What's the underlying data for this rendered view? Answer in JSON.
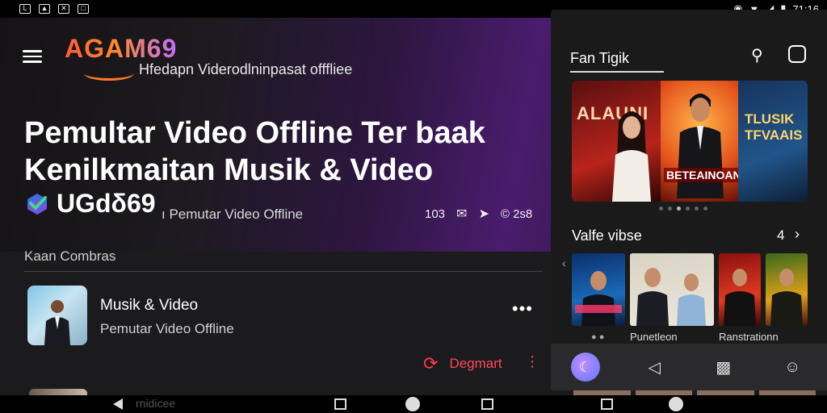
{
  "status_bar": {
    "left_icons": [
      "notification-icon",
      "photo-icon",
      "x-icon",
      "cast-icon"
    ],
    "time": "71:16"
  },
  "header": {
    "logo": "AGAM69",
    "tagline": "Hfedapn Viderodlninpasat offfliee"
  },
  "hero": {
    "headline_line1": "Pemultar Video Offline Ter baak",
    "headline_line2": "Kenilkmaitan Musik & Video",
    "brand_name": "UGdδ69",
    "sub_label": "ı Pemutar Video Offline",
    "stats": {
      "views": "103",
      "comments_icon": "chat-icon",
      "share_icon": "share-icon",
      "likes": "© 2s8"
    }
  },
  "section": {
    "label": "Kaan Combras"
  },
  "list_item": {
    "title": "Musik & Video",
    "subtitle": "Pemutar Video Offline",
    "more": "•••"
  },
  "download": {
    "label": "Degmart",
    "more": "⋮"
  },
  "side_panel": {
    "title": "Fan Tigik",
    "banner": {
      "left_text": "ALAUNI",
      "center_text": "BETEAINOAN",
      "right_text": "TLUSIK TFVAAIS"
    },
    "carousel_dots": 6,
    "active_dot": 2,
    "row": {
      "title": "Valfe vibse",
      "count": "4",
      "arrow": "›",
      "prev": "‹"
    },
    "tile_captions": [
      "Punetleon",
      "Ranstrationn"
    ],
    "nav": [
      "home-icon",
      "audio-icon",
      "chat-icon",
      "user-icon"
    ]
  },
  "system_nav": {
    "back_label": "rnidicee"
  },
  "colors": {
    "accent_red": "#ff4a55",
    "logo_orange": "#ff7a2a",
    "panel_bg": "#1a1a1a",
    "hero_purple": "#4a1c6e"
  }
}
